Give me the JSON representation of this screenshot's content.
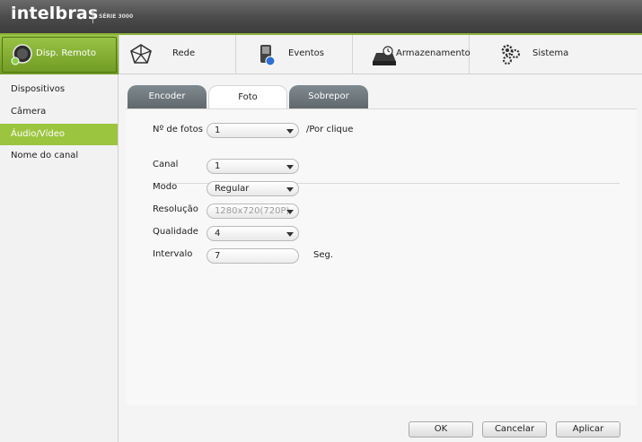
{
  "brand": {
    "logo_text": "intelbras",
    "series_text": "SÉRIE 3000"
  },
  "topnav": {
    "items": [
      {
        "label": "Disp. Remoto",
        "icon": "remote-device-icon",
        "active": true
      },
      {
        "label": "Rede",
        "icon": "network-icon",
        "active": false
      },
      {
        "label": "Eventos",
        "icon": "events-icon",
        "active": false
      },
      {
        "label": "Armazenamento",
        "icon": "storage-icon",
        "active": false
      },
      {
        "label": "Sistema",
        "icon": "gears-icon",
        "active": false
      }
    ]
  },
  "sidebar": {
    "items": [
      {
        "label": "Dispositivos",
        "active": false
      },
      {
        "label": "Câmera",
        "active": false
      },
      {
        "label": "Áudio/Vídeo",
        "active": true
      },
      {
        "label": "Nome do canal",
        "active": false
      }
    ]
  },
  "tabs": [
    {
      "label": "Encoder",
      "active": false
    },
    {
      "label": "Foto",
      "active": true
    },
    {
      "label": "Sobrepor",
      "active": false
    }
  ],
  "form": {
    "photos_label": "Nº de fotos",
    "photos_value": "1",
    "photos_suffix": "/Por clique",
    "canal_label": "Canal",
    "canal_value": "1",
    "modo_label": "Modo",
    "modo_value": "Regular",
    "resolucao_label": "Resolução",
    "resolucao_value": "1280x720(720P)",
    "qualidade_label": "Qualidade",
    "qualidade_value": "4",
    "intervalo_label": "Intervalo",
    "intervalo_value": "7",
    "intervalo_suffix": "Seg."
  },
  "buttons": {
    "ok": "OK",
    "cancel": "Cancelar",
    "apply": "Aplicar"
  },
  "colors": {
    "accent": "#9cc53f",
    "titlebar": "#4a4a4a"
  }
}
